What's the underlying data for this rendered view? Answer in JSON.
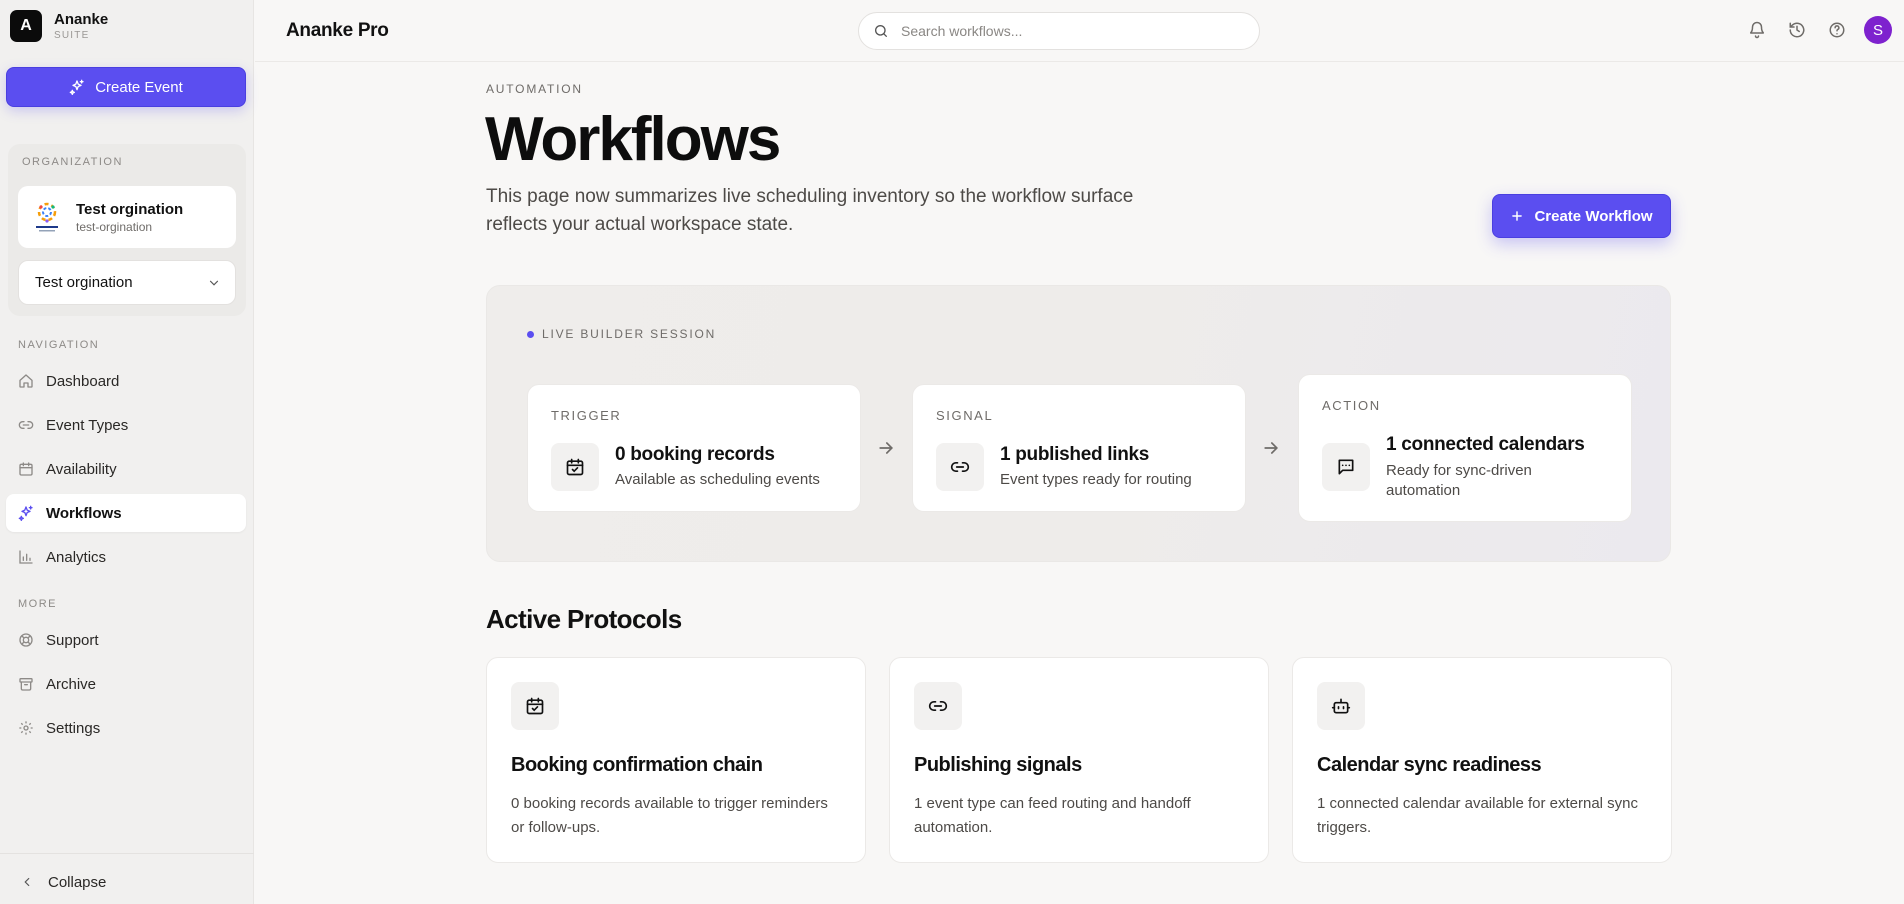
{
  "brand": {
    "logo_letter": "A",
    "name": "Ananke",
    "subtitle": "SUITE"
  },
  "sidebar": {
    "create_event_label": "Create Event",
    "organization": {
      "section_label": "ORGANIZATION",
      "name": "Test orgination",
      "slug": "test-orgination",
      "selected": "Test orgination"
    },
    "nav_label": "NAVIGATION",
    "nav_items": [
      {
        "label": "Dashboard",
        "icon": "home-icon"
      },
      {
        "label": "Event Types",
        "icon": "link-icon"
      },
      {
        "label": "Availability",
        "icon": "calendar-icon"
      },
      {
        "label": "Workflows",
        "icon": "sparkle-icon",
        "active": true
      },
      {
        "label": "Analytics",
        "icon": "bar-chart-icon"
      }
    ],
    "more_label": "MORE",
    "more_items": [
      {
        "label": "Support",
        "icon": "lifebuoy-icon"
      },
      {
        "label": "Archive",
        "icon": "archive-icon"
      },
      {
        "label": "Settings",
        "icon": "gear-icon"
      }
    ],
    "collapse_label": "Collapse"
  },
  "topbar": {
    "title": "Ananke Pro",
    "search_placeholder": "Search workflows...",
    "user_initial": "S"
  },
  "page": {
    "eyebrow": "AUTOMATION",
    "title": "Workflows",
    "description": "This page now summarizes live scheduling inventory so the workflow surface reflects your actual workspace state.",
    "create_workflow_label": "Create Workflow"
  },
  "session": {
    "label": "LIVE BUILDER SESSION",
    "cards": [
      {
        "kicker": "TRIGGER",
        "title": "0 booking records",
        "subtitle": "Available as scheduling events",
        "icon": "calendar-icon"
      },
      {
        "kicker": "SIGNAL",
        "title": "1 published links",
        "subtitle": "Event types ready for routing",
        "icon": "link-icon"
      },
      {
        "kicker": "ACTION",
        "title": "1 connected calendars",
        "subtitle": "Ready for sync-driven automation",
        "icon": "message-icon"
      }
    ]
  },
  "protocols": {
    "title": "Active Protocols",
    "cards": [
      {
        "title": "Booking confirmation chain",
        "description": "0 booking records available to trigger reminders or follow-ups.",
        "icon": "calendar-icon"
      },
      {
        "title": "Publishing signals",
        "description": "1 event type can feed routing and handoff automation.",
        "icon": "link-icon"
      },
      {
        "title": "Calendar sync readiness",
        "description": "1 connected calendar available for external sync triggers.",
        "icon": "bot-icon"
      }
    ]
  },
  "colors": {
    "accent": "#5b4ef0",
    "avatar": "#7e22ce"
  }
}
